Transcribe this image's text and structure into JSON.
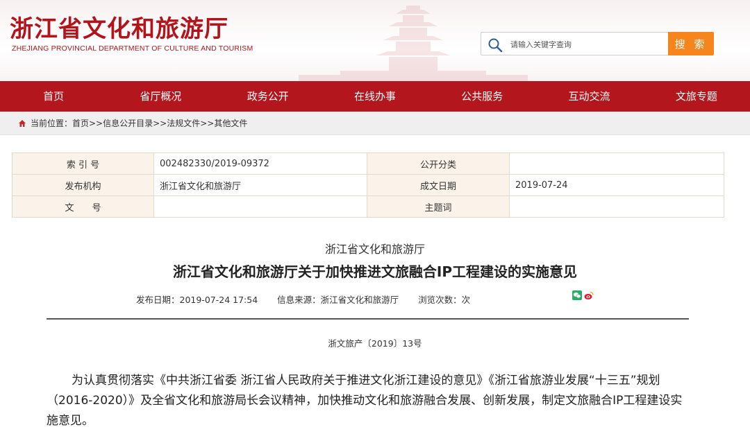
{
  "header": {
    "title": "浙江省文化和旅游厅",
    "subtitle": "ZHEJIANG PROVINCIAL DEPARTMENT OF CULTURE AND TOURISM",
    "search_placeholder": "请输入关键字查询",
    "search_button": "搜 索"
  },
  "nav": {
    "items": [
      "首页",
      "省厅概况",
      "政务公开",
      "在线办事",
      "公共服务",
      "互动交流",
      "文旅专题"
    ]
  },
  "breadcrumb": "当前位置：首页>>信息公开目录>>法规文件>>其他文件",
  "info_table": {
    "index_label": "索 引 号",
    "index_value": "002482330/2019-09372",
    "category_label": "公开分类",
    "category_value": "",
    "issuer_label": "发布机构",
    "issuer_value": "浙江省文化和旅游厅",
    "date_label": "成文日期",
    "date_value": "2019-07-24",
    "docno_label": "文　　号",
    "docno_value": "",
    "topic_label": "主题词",
    "topic_value": ""
  },
  "article": {
    "source_top": "浙江省文化和旅游厅",
    "title": "浙江省文化和旅游厅关于加快推进文旅融合IP工程建设的实施意见",
    "publish_date": "发布日期：2019-07-24 17:54",
    "info_source": "信息来源：浙江省文化和旅游厅",
    "views": "浏览次数：次",
    "doc_number": "浙文旅产〔2019〕13号",
    "paragraph": "为认真贯彻落实《中共浙江省委  浙江省人民政府关于推进文化浙江建设的意见》《浙江省旅游业发展“十三五”规划（2016-2020）》及全省文化和旅游局长会议精神，加快推动文化和旅游融合发展、创新发展，制定文旅融合IP工程建设实施意见。"
  },
  "colors": {
    "brand_red": "#b3161d",
    "search_orange": "#f7851e",
    "wechat_green": "#2aae67",
    "weibo_red": "#e6162d"
  },
  "icons": [
    "search-icon",
    "home-icon",
    "wechat-icon",
    "weibo-icon"
  ]
}
